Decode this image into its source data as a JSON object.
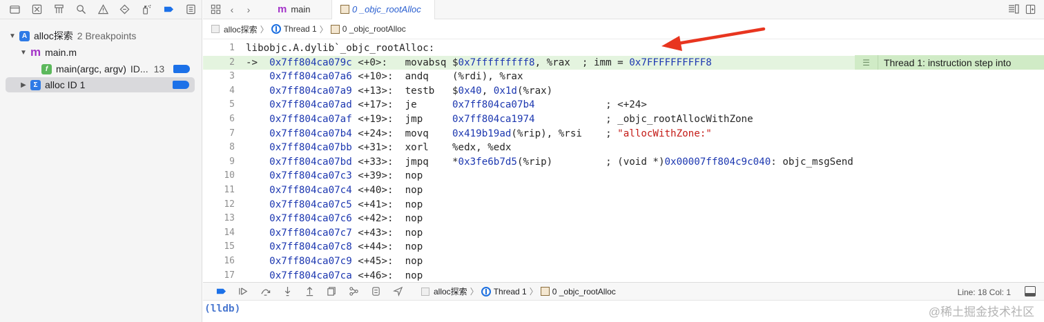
{
  "navigator": {
    "toolbar_icons": [
      "folder-icon",
      "close-box-icon",
      "hierarchy-icon",
      "search-icon",
      "warning-icon",
      "test-diamond-icon",
      "debug-spray-icon",
      "breakpoint-icon",
      "report-list-icon"
    ],
    "tree": [
      {
        "kind": "project",
        "disclosure": "expanded",
        "label": "alloc探索",
        "detail": "2 Breakpoints"
      },
      {
        "kind": "file",
        "disclosure": "expanded",
        "label": "main.m"
      },
      {
        "kind": "function",
        "label": "main(argc, argv)",
        "detail": "ID...",
        "line": "13"
      },
      {
        "kind": "symbolic",
        "disclosure": "collapsed",
        "label": "alloc ID 1",
        "selected": true
      }
    ]
  },
  "editor": {
    "tabs": [
      {
        "label": "main",
        "icon": "m",
        "active": false
      },
      {
        "label": "0 _objc_rootAlloc",
        "active": true
      }
    ],
    "jumpbar": [
      "alloc探索",
      "Thread 1",
      "0 _objc_rootAlloc"
    ]
  },
  "code": {
    "lines": [
      {
        "n": "1",
        "text": "libobjc.A.dylib`_objc_rootAlloc:",
        "current": false
      },
      {
        "n": "2",
        "marker": "->",
        "addr": "0x7ff804ca079c",
        "off": "<+0>:",
        "op": "movabsq",
        "args": "$0x7fffffffff8, %rax",
        "comment": "; imm = ",
        "comment_val": "0x7FFFFFFFFFF8",
        "current": true
      },
      {
        "n": "3",
        "addr": "0x7ff804ca07a6",
        "off": "<+10>:",
        "op": "andq",
        "args": "(%rdi), %rax"
      },
      {
        "n": "4",
        "addr": "0x7ff804ca07a9",
        "off": "<+13>:",
        "op": "testb",
        "args": "$0x40, 0x1d(%rax)"
      },
      {
        "n": "5",
        "addr": "0x7ff804ca07ad",
        "off": "<+17>:",
        "op": "je",
        "args": "0x7ff804ca07b4",
        "comment": "; <+24>"
      },
      {
        "n": "6",
        "addr": "0x7ff804ca07af",
        "off": "<+19>:",
        "op": "jmp",
        "args": "0x7ff804ca1974",
        "comment": "; _objc_rootAllocWithZone"
      },
      {
        "n": "7",
        "addr": "0x7ff804ca07b4",
        "off": "<+24>:",
        "op": "movq",
        "args": "0x419b19ad(%rip), %rsi",
        "comment": "; ",
        "comment_str": "\"allocWithZone:\""
      },
      {
        "n": "8",
        "addr": "0x7ff804ca07bb",
        "off": "<+31>:",
        "op": "xorl",
        "args": "%edx, %edx"
      },
      {
        "n": "9",
        "addr": "0x7ff804ca07bd",
        "off": "<+33>:",
        "op": "jmpq",
        "args": "*0x3fe6b7d5(%rip)",
        "comment": "; (void *)",
        "comment_val": "0x00007ff804c9c040",
        "comment_tail": ": objc_msgSend"
      },
      {
        "n": "10",
        "addr": "0x7ff804ca07c3",
        "off": "<+39>:",
        "op": "nop"
      },
      {
        "n": "11",
        "addr": "0x7ff804ca07c4",
        "off": "<+40>:",
        "op": "nop"
      },
      {
        "n": "12",
        "addr": "0x7ff804ca07c5",
        "off": "<+41>:",
        "op": "nop"
      },
      {
        "n": "13",
        "addr": "0x7ff804ca07c6",
        "off": "<+42>:",
        "op": "nop"
      },
      {
        "n": "14",
        "addr": "0x7ff804ca07c7",
        "off": "<+43>:",
        "op": "nop"
      },
      {
        "n": "15",
        "addr": "0x7ff804ca07c8",
        "off": "<+44>:",
        "op": "nop"
      },
      {
        "n": "16",
        "addr": "0x7ff804ca07c9",
        "off": "<+45>:",
        "op": "nop"
      },
      {
        "n": "17",
        "addr": "0x7ff804ca07ca",
        "off": "<+46>:",
        "op": "nop"
      }
    ],
    "annotation": "Thread 1: instruction step into"
  },
  "debug_bar": {
    "icons": [
      "breakpoints-toggle-icon",
      "continue-icon",
      "step-over-icon",
      "step-into-icon",
      "step-out-icon",
      "view-hierarchy-icon",
      "memory-graph-icon",
      "environment-icon",
      "location-icon"
    ],
    "jumpbar": [
      "alloc探索",
      "Thread 1",
      "0 _objc_rootAlloc"
    ],
    "status": "Line: 18  Col: 1"
  },
  "console": {
    "prompt": "(lldb)",
    "watermark": "@稀土掘金技术社区"
  },
  "colors": {
    "accent": "#1c71e8",
    "current_line": "#e4f4df",
    "annotation_bg": "#d0ebc6",
    "address": "#1c37b0",
    "string": "#c41a16",
    "arrow": "#e8351f"
  }
}
